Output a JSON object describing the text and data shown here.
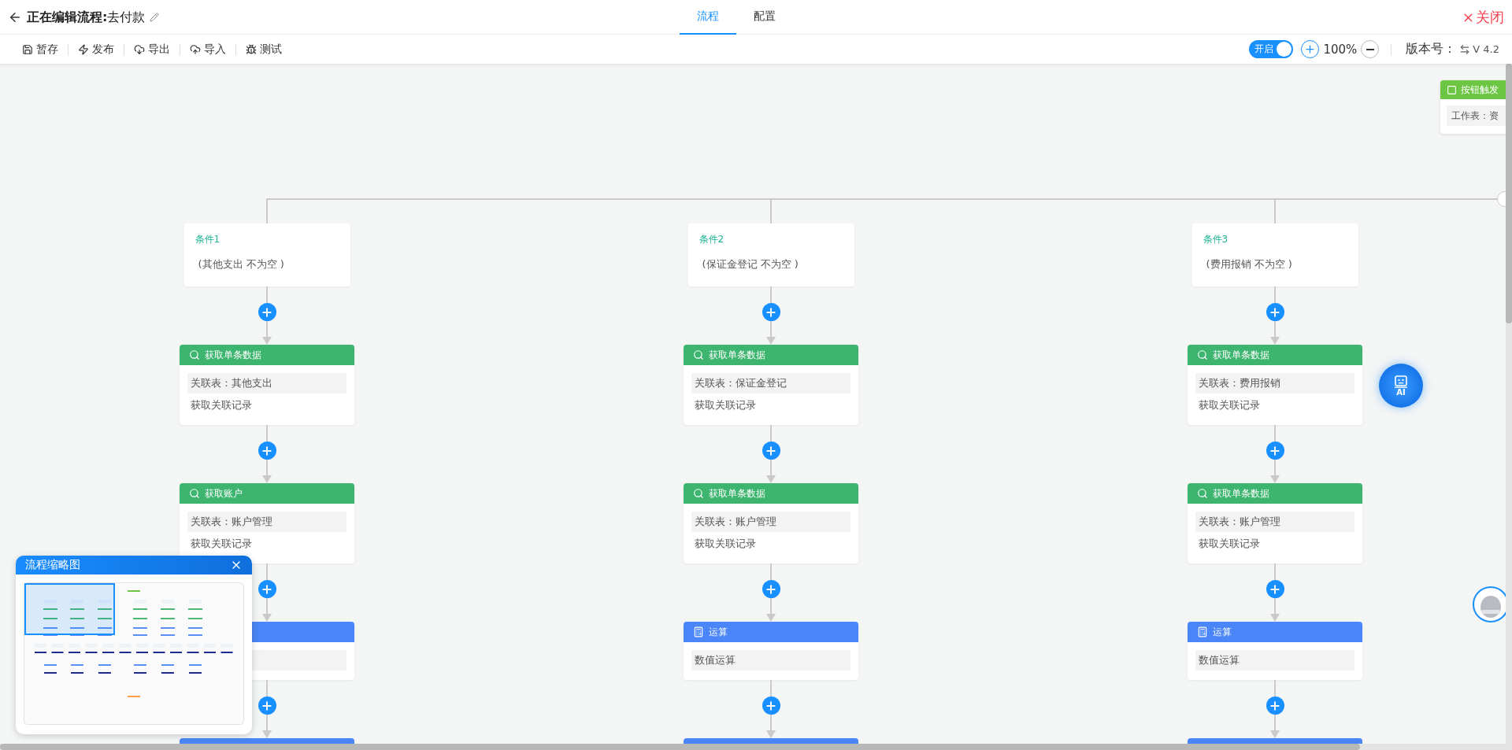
{
  "header": {
    "title": "**正在编辑流程:**去付款",
    "tabs": [
      {
        "label": "流程",
        "selected": true
      },
      {
        "label": "配置",
        "selected": false
      }
    ],
    "close": "关闭"
  },
  "toolbar": {
    "actions": [
      "暂存",
      "发布",
      "导出",
      "导入",
      "测试"
    ],
    "toggle": {
      "label": "开启",
      "on": true
    },
    "zoom": "100%",
    "version_label": "版本号：",
    "version": "V 4.2"
  },
  "canvas": {
    "trigger": {
      "title": "按钮触发",
      "field": "工作表：资"
    },
    "branches": [
      {
        "condition": {
          "label": "条件1",
          "text": "(其他支出 不为空 )"
        },
        "nodes": [
          {
            "kind": "fetch",
            "title": "获取单条数据",
            "fields": [
              {
                "kind": "field",
                "text": "关联表：其他支出"
              },
              {
                "kind": "line",
                "text": "获取关联记录"
              }
            ]
          },
          {
            "kind": "fetch",
            "title": "获取账户",
            "fields": [
              {
                "kind": "field",
                "text": "关联表：账户管理"
              },
              {
                "kind": "line",
                "text": "获取关联记录"
              }
            ]
          },
          {
            "kind": "calc",
            "fields": [
              {
                "kind": "field"
              }
            ]
          },
          {
            "kind": "calc"
          }
        ]
      },
      {
        "condition": {
          "label": "条件2",
          "text": "(保证金登记 不为空 )"
        },
        "nodes": [
          {
            "kind": "fetch",
            "title": "获取单条数据",
            "fields": [
              {
                "kind": "field",
                "text": "关联表：保证金登记"
              },
              {
                "kind": "line",
                "text": "获取关联记录"
              }
            ]
          },
          {
            "kind": "fetch",
            "title": "获取单条数据",
            "fields": [
              {
                "kind": "field",
                "text": "关联表：账户管理"
              },
              {
                "kind": "line",
                "text": "获取关联记录"
              }
            ]
          },
          {
            "kind": "calc",
            "title": "运算",
            "fields": [
              {
                "kind": "field",
                "text": "数值运算"
              }
            ]
          },
          {
            "kind": "calc"
          }
        ]
      },
      {
        "condition": {
          "label": "条件3",
          "text": "(费用报销 不为空 )"
        },
        "nodes": [
          {
            "kind": "fetch",
            "title": "获取单条数据",
            "fields": [
              {
                "kind": "field",
                "text": "关联表：费用报销"
              },
              {
                "kind": "line",
                "text": "获取关联记录"
              }
            ]
          },
          {
            "kind": "fetch",
            "title": "获取单条数据",
            "fields": [
              {
                "kind": "field",
                "text": "关联表：账户管理"
              },
              {
                "kind": "line",
                "text": "获取关联记录"
              }
            ]
          },
          {
            "kind": "calc",
            "title": "运算",
            "fields": [
              {
                "kind": "field",
                "text": "数值运算"
              }
            ]
          },
          {
            "kind": "calc"
          }
        ]
      }
    ]
  },
  "minimap": {
    "title": "流程缩略图"
  },
  "ai_button": {
    "label": "AI"
  }
}
